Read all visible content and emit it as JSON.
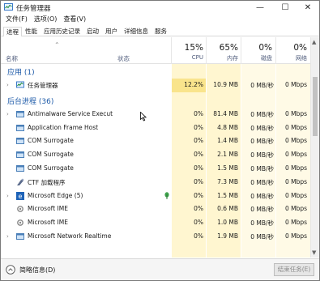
{
  "window": {
    "title": "任务管理器",
    "min_glyph": "—",
    "max_glyph": "☐",
    "close_glyph": "✕"
  },
  "menu": [
    "文件(F)",
    "选项(O)",
    "查看(V)"
  ],
  "tabs": [
    "进程",
    "性能",
    "应用历史记录",
    "启动",
    "用户",
    "详细信息",
    "服务"
  ],
  "active_tab": "进程",
  "columns": {
    "name": "名称",
    "status": "状态",
    "cpu": {
      "pct": "15%",
      "label": "CPU"
    },
    "memory": {
      "pct": "65%",
      "label": "内存"
    },
    "disk": {
      "pct": "0%",
      "label": "磁盘"
    },
    "network": {
      "pct": "0%",
      "label": "网络"
    }
  },
  "groups": {
    "apps": "应用 (1)",
    "background": "后台进程 (36)"
  },
  "processes": [
    {
      "name": "任务管理器",
      "cpu": "12.2%",
      "mem": "10.9 MB",
      "disk": "0 MB/秒",
      "net": "0 Mbps",
      "expand": true,
      "icon": "task-manager-icon",
      "group": "apps"
    },
    {
      "name": "Antimalware Service Executa...",
      "cpu": "0%",
      "mem": "81.4 MB",
      "disk": "0 MB/秒",
      "net": "0 Mbps",
      "expand": true,
      "icon": "service-icon",
      "group": "background"
    },
    {
      "name": "Application Frame Host",
      "cpu": "0%",
      "mem": "4.8 MB",
      "disk": "0 MB/秒",
      "net": "0 Mbps",
      "expand": false,
      "icon": "app-frame-icon",
      "group": "background"
    },
    {
      "name": "COM Surrogate",
      "cpu": "0%",
      "mem": "1.4 MB",
      "disk": "0 MB/秒",
      "net": "0 Mbps",
      "expand": false,
      "icon": "app-frame-icon",
      "group": "background"
    },
    {
      "name": "COM Surrogate",
      "cpu": "0%",
      "mem": "2.1 MB",
      "disk": "0 MB/秒",
      "net": "0 Mbps",
      "expand": false,
      "icon": "app-frame-icon",
      "group": "background"
    },
    {
      "name": "COM Surrogate",
      "cpu": "0%",
      "mem": "1.5 MB",
      "disk": "0 MB/秒",
      "net": "0 Mbps",
      "expand": false,
      "icon": "app-frame-icon",
      "group": "background"
    },
    {
      "name": "CTF 加载程序",
      "cpu": "0%",
      "mem": "7.3 MB",
      "disk": "0 MB/秒",
      "net": "0 Mbps",
      "expand": false,
      "icon": "ctf-loader-icon",
      "group": "background"
    },
    {
      "name": "Microsoft Edge (5)",
      "cpu": "0%",
      "mem": "1.5 MB",
      "disk": "0 MB/秒",
      "net": "0 Mbps",
      "expand": true,
      "icon": "edge-icon",
      "group": "background",
      "suspended": true
    },
    {
      "name": "Microsoft IME",
      "cpu": "0%",
      "mem": "0.6 MB",
      "disk": "0 MB/秒",
      "net": "0 Mbps",
      "expand": false,
      "icon": "ime-icon",
      "group": "background"
    },
    {
      "name": "Microsoft IME",
      "cpu": "0%",
      "mem": "1.0 MB",
      "disk": "0 MB/秒",
      "net": "0 Mbps",
      "expand": false,
      "icon": "ime-icon",
      "group": "background"
    },
    {
      "name": "Microsoft Network Realtime ...",
      "cpu": "0%",
      "mem": "1.9 MB",
      "disk": "0 MB/秒",
      "net": "0 Mbps",
      "expand": true,
      "icon": "service-icon",
      "group": "background"
    }
  ],
  "footer": {
    "fewer_details": "简略信息(D)",
    "end_task": "结束任务(E)"
  },
  "colors": {
    "group_blue": "#1d5aa8",
    "cpu_hot": "#f9e48c",
    "col_tint": "#fff6d0",
    "col_tint_light": "#fffae6"
  }
}
